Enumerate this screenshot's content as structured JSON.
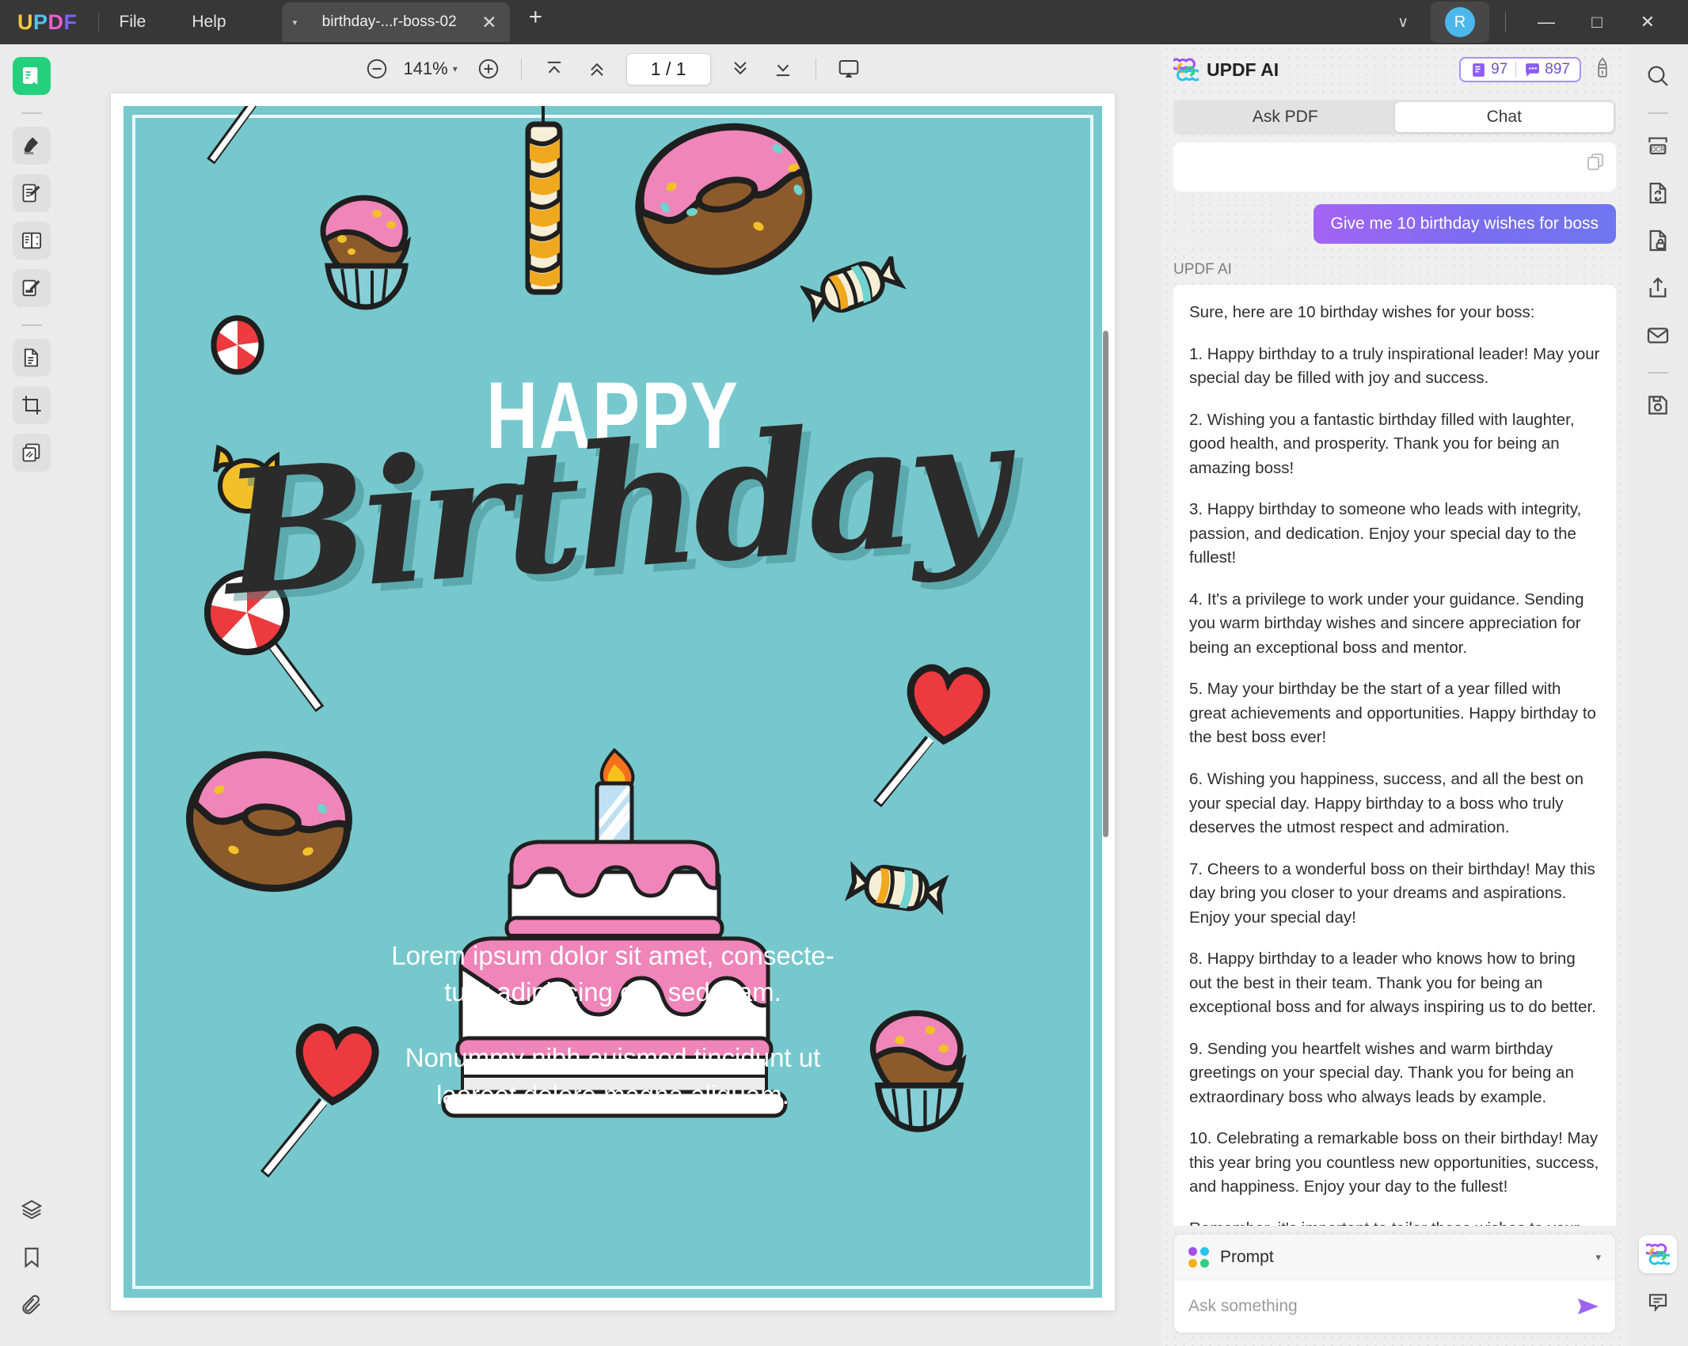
{
  "titlebar": {
    "logo": "UPDF",
    "menus": [
      "File",
      "Help"
    ],
    "tab": {
      "title": "birthday-...r-boss-02",
      "caret": "▾",
      "close": "✕"
    },
    "new_tab": "+",
    "chevron": "∨",
    "avatar_initial": "R",
    "window": {
      "minimize": "—",
      "maximize": "□",
      "close": "✕"
    }
  },
  "left_rail": {
    "items": [
      {
        "name": "reader-mode",
        "icon": "book-reader-icon",
        "active": true
      },
      {
        "name": "highlighter",
        "icon": "highlighter-icon",
        "active": false
      },
      {
        "name": "comment",
        "icon": "comment-edit-icon",
        "active": false
      },
      {
        "name": "organize-pages",
        "icon": "organize-pages-icon",
        "active": false
      },
      {
        "name": "edit-pdf",
        "icon": "edit-pdf-icon",
        "active": false
      },
      {
        "name": "convert-pdf",
        "icon": "document-copy-icon",
        "active": false
      },
      {
        "name": "crop-page",
        "icon": "crop-icon",
        "active": false
      },
      {
        "name": "batch-process",
        "icon": "batch-pages-icon",
        "active": false
      }
    ],
    "bottom_items": [
      {
        "name": "layers",
        "icon": "layers-icon"
      },
      {
        "name": "bookmarks",
        "icon": "bookmark-icon"
      },
      {
        "name": "attachments",
        "icon": "paperclip-icon"
      }
    ]
  },
  "right_rail": {
    "items": [
      {
        "name": "search",
        "icon": "search-icon"
      },
      {
        "name": "ocr",
        "icon": "ocr-icon"
      },
      {
        "name": "convert",
        "icon": "convert-file-icon"
      },
      {
        "name": "protect",
        "icon": "lock-file-icon"
      },
      {
        "name": "share",
        "icon": "share-icon"
      },
      {
        "name": "email",
        "icon": "envelope-icon"
      },
      {
        "name": "save",
        "icon": "floppy-save-icon"
      }
    ],
    "bottom_items": [
      {
        "name": "updf-ai",
        "icon": "updf-ai-icon"
      },
      {
        "name": "comments-panel",
        "icon": "speech-bubble-icon"
      }
    ]
  },
  "doc_toolbar": {
    "zoom_out": "−",
    "zoom_value": "141%",
    "zoom_caret": "▾",
    "zoom_in": "+",
    "first_page": "first-page-icon",
    "prev_page": "prev-page-icon",
    "page_indicator": "1 / 1",
    "next_page": "next-page-icon",
    "last_page": "last-page-icon",
    "present": "present-mode-icon"
  },
  "document": {
    "heading_top": "HAPPY",
    "heading_script": "Birthday",
    "paragraphs": [
      "Lorem ipsum dolor sit amet, consecte-\ntuer adipiscing elit, sed diam.",
      "Nonummy nibh euismod tincidunt ut\nlaoreet dolore magna aliquam."
    ],
    "bg_color": "#76c8cd",
    "accent_pink": "#ef85b9",
    "accent_red": "#ef3f44",
    "accent_brown": "#8d5b2b"
  },
  "ai_panel": {
    "title": "UPDF AI",
    "logo_icon": "updf-ai-clover-icon",
    "credits": {
      "pages_icon": "pages-credit-icon",
      "pages": "97",
      "chat_icon": "chat-credit-icon",
      "chat": "897"
    },
    "clear_icon": "clear-brush-icon",
    "tabs": [
      {
        "label": "Ask PDF",
        "selected": false
      },
      {
        "label": "Chat",
        "selected": true
      }
    ],
    "copy_icon": "copy-icon",
    "user_message": "Give me 10 birthday wishes for boss",
    "assistant_name": "UPDF AI",
    "assistant_message": [
      "Sure, here are 10 birthday wishes for your boss:",
      "1. Happy birthday to a truly inspirational leader! May your special day be filled with joy and success.",
      "2. Wishing you a fantastic birthday filled with laughter, good health, and prosperity. Thank you for being an amazing boss!",
      "3. Happy birthday to someone who leads with integrity, passion, and dedication. Enjoy your special day to the fullest!",
      "4. It's a privilege to work under your guidance. Sending you warm birthday wishes and sincere appreciation for being an exceptional boss and mentor.",
      "5. May your birthday be the start of a year filled with great achievements and opportunities. Happy birthday to the best boss ever!",
      "6. Wishing you happiness, success, and all the best on your special day. Happy birthday to a boss who truly deserves the utmost respect and admiration.",
      "7. Cheers to a wonderful boss on their birthday! May this day bring you closer to your dreams and aspirations. Enjoy your special day!",
      "8. Happy birthday to a leader who knows how to bring out the best in their team. Thank you for being an exceptional boss and for always inspiring us to do better.",
      "9. Sending you heartfelt wishes and warm birthday greetings on your special day. Thank you for being an extraordinary boss who always leads by example.",
      "10. Celebrating a remarkable boss on their birthday! May this year bring you countless new opportunities, success, and happiness. Enjoy your day to the fullest!",
      "Remember, it's important to tailor these wishes to your boss's personality and your professional relationship with them."
    ],
    "composer": {
      "prompt_label": "Prompt",
      "prompt_caret": "▾",
      "input_placeholder": "Ask something",
      "input_value": "",
      "send_icon": "send-icon"
    }
  },
  "colors": {
    "accent_purple": "#7a6df0",
    "accent_green": "#25d07d",
    "titlebar": "#373737",
    "panel_bg": "#efefef"
  }
}
